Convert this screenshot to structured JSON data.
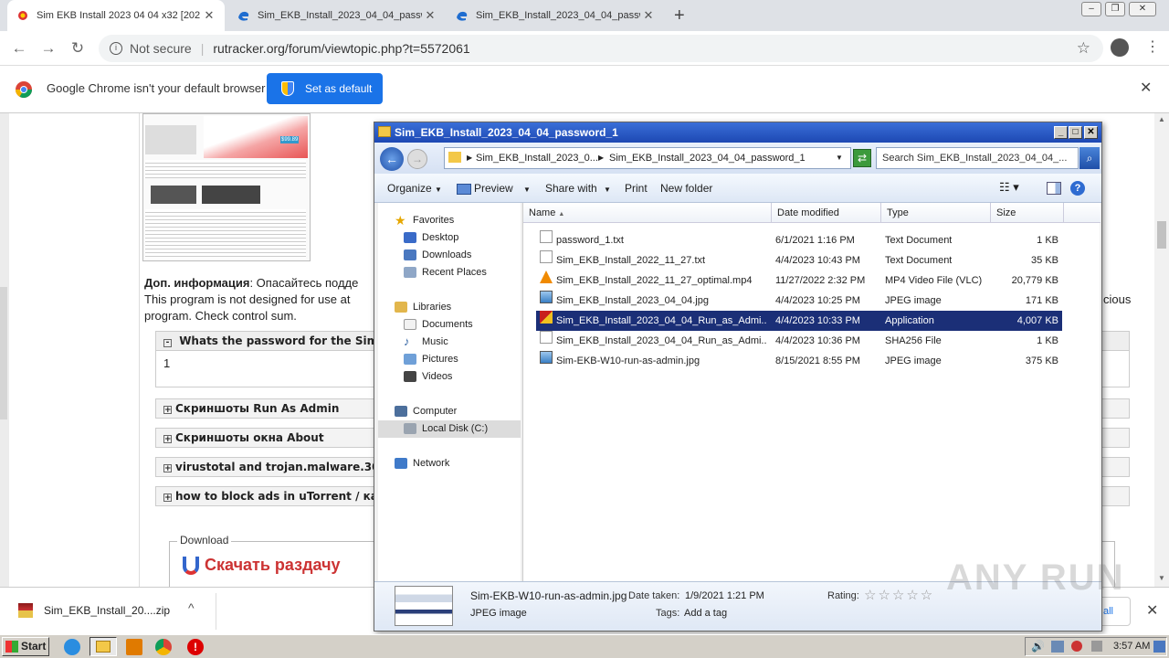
{
  "browser": {
    "tabs": [
      {
        "label": "Sim EKB Install 2023 04 04 x32 [202"
      },
      {
        "label": "Sim_EKB_Install_2023_04_04_passw"
      },
      {
        "label": "Sim_EKB_Install_2023_04_04_passw"
      }
    ],
    "url_security": "Not secure",
    "url": "rutracker.org/forum/viewtopic.php?t=5572061",
    "infobar_text": "Google Chrome isn't your default browser",
    "infobar_button": "Set as default"
  },
  "page": {
    "info_label": "Доп. информация",
    "info_text": ": Опасайтесь подде",
    "line2": "This program is not designed for use at",
    "line2_right": "cious",
    "line3": "program. Check control sum.",
    "spoiler_open": "Whats the password for the Sim_",
    "spoiler_open_value": "1",
    "spoilers": [
      "Скриншоты Run As Admin",
      "Скриншоты окна About",
      "virustotal and trojan.malware.30",
      "how to block ads in uTorrent / ка"
    ],
    "side_snippet": "ъ]",
    "download_legend": "Download",
    "download_button": "Скачать раздачу",
    "thumb_price": "$99.89"
  },
  "download_bar": {
    "file": "Sim_EKB_Install_20....zip",
    "show_all": "w all"
  },
  "explorer": {
    "title": "Sim_EKB_Install_2023_04_04_password_1",
    "breadcrumb": [
      "Sim_EKB_Install_2023_0...",
      "Sim_EKB_Install_2023_04_04_password_1"
    ],
    "search_placeholder": "Search Sim_EKB_Install_2023_04_04_...",
    "commands": [
      "Organize",
      "Preview",
      "Share with",
      "Print",
      "New folder"
    ],
    "nav": {
      "favorites": "Favorites",
      "desktop": "Desktop",
      "downloads": "Downloads",
      "recent": "Recent Places",
      "libraries": "Libraries",
      "documents": "Documents",
      "music": "Music",
      "pictures": "Pictures",
      "videos": "Videos",
      "computer": "Computer",
      "local_disk": "Local Disk (C:)",
      "network": "Network"
    },
    "columns": [
      "Name",
      "Date modified",
      "Type",
      "Size"
    ],
    "files": [
      {
        "name": "password_1.txt",
        "date": "6/1/2021 1:16 PM",
        "type": "Text Document",
        "size": "1 KB"
      },
      {
        "name": "Sim_EKB_Install_2022_11_27.txt",
        "date": "4/4/2023 10:43 PM",
        "type": "Text Document",
        "size": "35 KB"
      },
      {
        "name": "Sim_EKB_Install_2022_11_27_optimal.mp4",
        "date": "11/27/2022 2:32 PM",
        "type": "MP4 Video File (VLC)",
        "size": "20,779 KB"
      },
      {
        "name": "Sim_EKB_Install_2023_04_04.jpg",
        "date": "4/4/2023 10:25 PM",
        "type": "JPEG image",
        "size": "171 KB"
      },
      {
        "name": "Sim_EKB_Install_2023_04_04_Run_as_Admi...",
        "date": "4/4/2023 10:33 PM",
        "type": "Application",
        "size": "4,007 KB"
      },
      {
        "name": "Sim_EKB_Install_2023_04_04_Run_as_Admi...",
        "date": "4/4/2023 10:36 PM",
        "type": "SHA256 File",
        "size": "1 KB"
      },
      {
        "name": "Sim-EKB-W10-run-as-admin.jpg",
        "date": "8/15/2021 8:55 PM",
        "type": "JPEG image",
        "size": "375 KB"
      }
    ],
    "details": {
      "name": "Sim-EKB-W10-run-as-admin.jpg",
      "date_label": "Date taken:",
      "date_value": "1/9/2021 1:21 PM",
      "kind": "JPEG image",
      "tags_label": "Tags:",
      "tags_value": "Add a tag",
      "rating_label": "Rating:"
    }
  },
  "taskbar": {
    "start": "Start",
    "clock": "3:57 AM"
  },
  "watermark": "ANY RUN",
  "colors": {
    "selection": "#1b2f77",
    "title_bar": "#2a5bc7",
    "chrome_button": "#1a73e8"
  }
}
